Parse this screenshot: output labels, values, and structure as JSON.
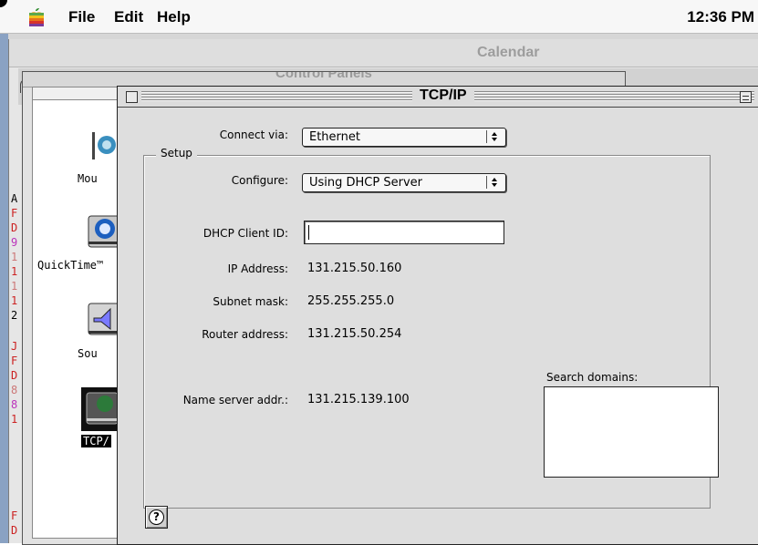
{
  "menubar": {
    "menus": [
      "File",
      "Edit",
      "Help"
    ],
    "clock": "12:36 PM"
  },
  "background_windows": {
    "calendar_title": "Calendar",
    "control_panels_title": "Control Panels",
    "calendar_sidebar_letters": [
      "A",
      "F",
      "D",
      "9",
      "1",
      "1",
      "1",
      "1",
      "2",
      "J",
      "F",
      "D",
      "8",
      "8",
      "1",
      "F",
      "D"
    ],
    "control_panel_items": [
      "Mou",
      "QuickTime™",
      "Sou",
      "TCP/"
    ]
  },
  "tcpip": {
    "title": "TCP/IP",
    "connect_via_label": "Connect via:",
    "connect_via_value": "Ethernet",
    "setup_label": "Setup",
    "configure_label": "Configure:",
    "configure_value": "Using DHCP Server",
    "dhcp_client_id_label": "DHCP Client ID:",
    "dhcp_client_id_value": "",
    "ip_address_label": "IP Address:",
    "ip_address_value": "131.215.50.160",
    "subnet_mask_label": "Subnet mask:",
    "subnet_mask_value": "255.255.255.0",
    "router_address_label": "Router address:",
    "router_address_value": "131.215.50.254",
    "name_server_label": "Name server addr.:",
    "name_server_value": "131.215.139.100",
    "search_domains_label": "Search domains:",
    "help_icon": "question-mark-icon"
  }
}
